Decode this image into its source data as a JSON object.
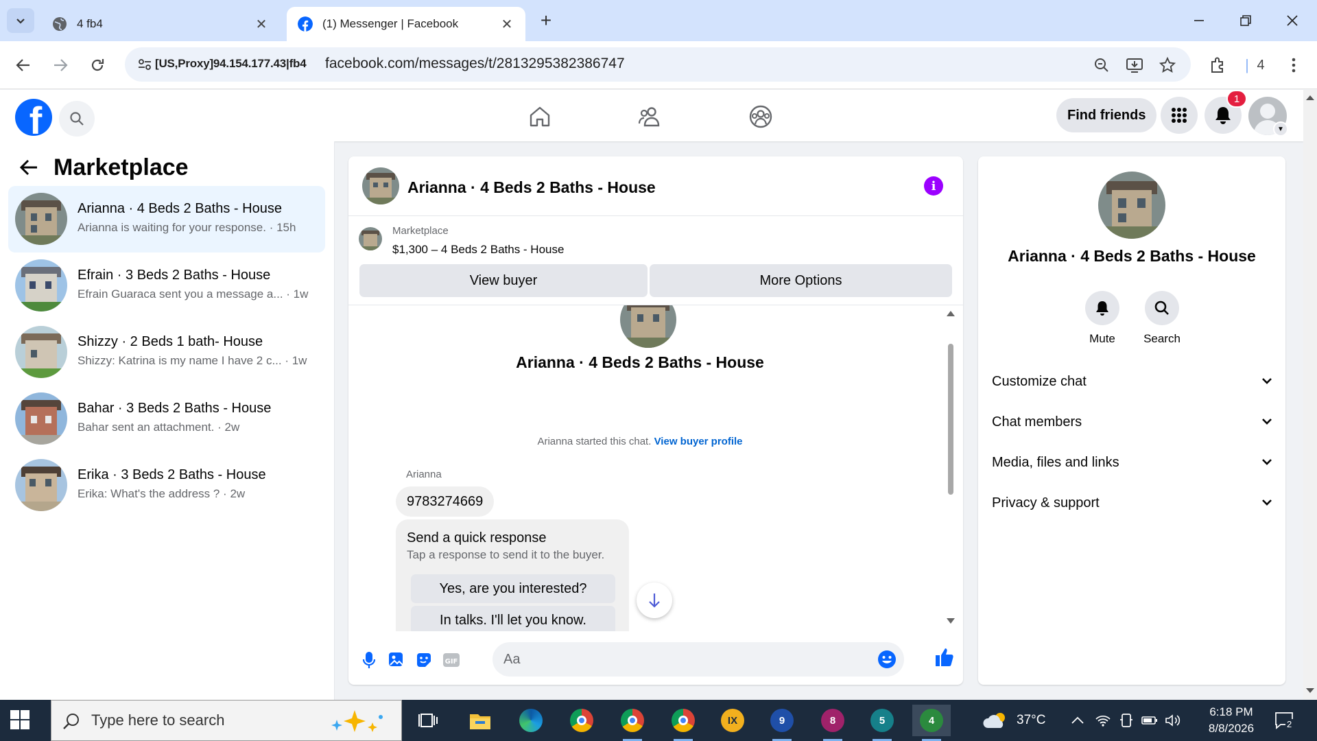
{
  "browser": {
    "tabs": [
      {
        "title": "4 fb4",
        "active": false
      },
      {
        "title": "(1) Messenger | Facebook",
        "active": true
      }
    ],
    "proxy_label": "[US,Proxy]94.154.177.43|fb4",
    "url": "facebook.com/messages/t/2813295382386747",
    "extension_count": "4"
  },
  "fb_header": {
    "find_friends_label": "Find friends",
    "notification_count": "1"
  },
  "sidebar": {
    "title": "Marketplace",
    "conversations": [
      {
        "name": "Arianna · 4 Beds 2 Baths - House",
        "snippet": "Arianna is waiting for your response. · 15h",
        "active": true
      },
      {
        "name": "Efrain · 3 Beds 2 Baths - House",
        "snippet": "Efrain Guaraca sent you a message a... · 1w",
        "active": false
      },
      {
        "name": "Shizzy · 2 Beds 1 bath- House",
        "snippet": "Shizzy: Katrina is my name I have 2 c... · 1w",
        "active": false
      },
      {
        "name": "Bahar · 3 Beds 2 Baths - House",
        "snippet": "Bahar sent an attachment. · 2w",
        "active": false
      },
      {
        "name": "Erika · 3 Beds 2 Baths - House",
        "snippet": "Erika: What's the address ? · 2w",
        "active": false
      }
    ]
  },
  "chat": {
    "title": "Arianna · 4 Beds 2 Baths - House",
    "listing": {
      "source": "Marketplace",
      "title": "$1,300 – 4 Beds 2 Baths - House",
      "view_buyer_label": "View buyer",
      "more_options_label": "More Options"
    },
    "intro_title": "Arianna · 4 Beds 2 Baths - House",
    "started_text": "Arianna started this chat.",
    "view_profile_link": "View buyer profile",
    "sender": "Arianna",
    "message": "9783274669",
    "quick_response": {
      "heading": "Send a quick response",
      "subtext": "Tap a response to send it to the buyer.",
      "options": [
        "Yes, are you interested?",
        "In talks. I'll let you know."
      ]
    },
    "composer_placeholder": "Aa"
  },
  "info_panel": {
    "name": "Arianna · 4 Beds 2 Baths - House",
    "mute_label": "Mute",
    "search_label": "Search",
    "sections": [
      "Customize chat",
      "Chat members",
      "Media, files and links",
      "Privacy & support"
    ]
  },
  "taskbar": {
    "search_placeholder": "Type here to search",
    "apps": [
      {
        "icon": "task-view-icon",
        "badge": ""
      },
      {
        "icon": "file-explorer-icon",
        "badge": ""
      },
      {
        "icon": "edge-icon",
        "badge": ""
      },
      {
        "icon": "chrome-icon",
        "badge": ""
      },
      {
        "icon": "chrome-profile-s-icon",
        "badge": ""
      },
      {
        "icon": "chrome-profile-a-icon",
        "badge": ""
      },
      {
        "icon": "ix-browser-icon",
        "badge": ""
      },
      {
        "icon": "browser-profile-9-icon",
        "badge": "9"
      },
      {
        "icon": "browser-profile-8-icon",
        "badge": "8"
      },
      {
        "icon": "browser-profile-5-icon",
        "badge": "5"
      },
      {
        "icon": "browser-profile-4-icon",
        "badge": "4"
      }
    ],
    "temperature": "37°C",
    "time": "6:18 PM",
    "date": "8/8/2026",
    "notification_count": "2"
  },
  "colors": {
    "fb_blue": "#0866ff",
    "active_conversation": "#ebf5ff",
    "info_purple": "#9b00ff",
    "link_blue": "#0064d1",
    "taskbar": "#1c2b3d"
  }
}
